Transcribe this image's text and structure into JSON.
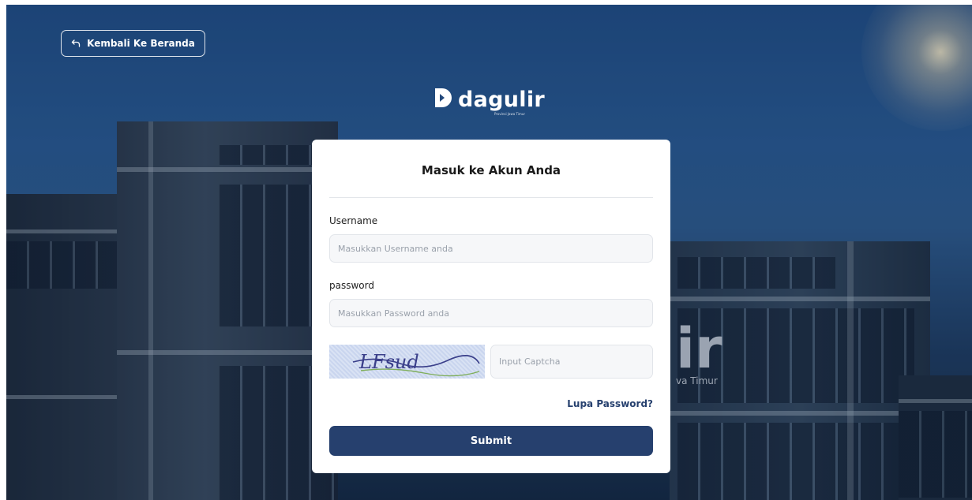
{
  "back_button": {
    "label": "Kembali Ke Beranda"
  },
  "logo": {
    "name": "dagulir",
    "tagline": "Provinsi Jawa Timur"
  },
  "login": {
    "title": "Masuk ke Akun Anda",
    "username_label": "Username",
    "username_placeholder": "Masukkan Username anda",
    "password_label": "password",
    "password_placeholder": "Masukkan Password anda",
    "captcha_text": "LFsud",
    "captcha_placeholder": "Input Captcha",
    "forgot_label": "Lupa Password?",
    "submit_label": "Submit"
  },
  "background": {
    "sign_fragment": "ir",
    "sign_sub_fragment": "va Timur"
  },
  "colors": {
    "primary": "#26406e",
    "card": "#ffffff",
    "input_bg": "#f6f7f9"
  },
  "icons": {
    "back": "return-arrow-icon",
    "logo": "dagulir-logo-icon"
  }
}
